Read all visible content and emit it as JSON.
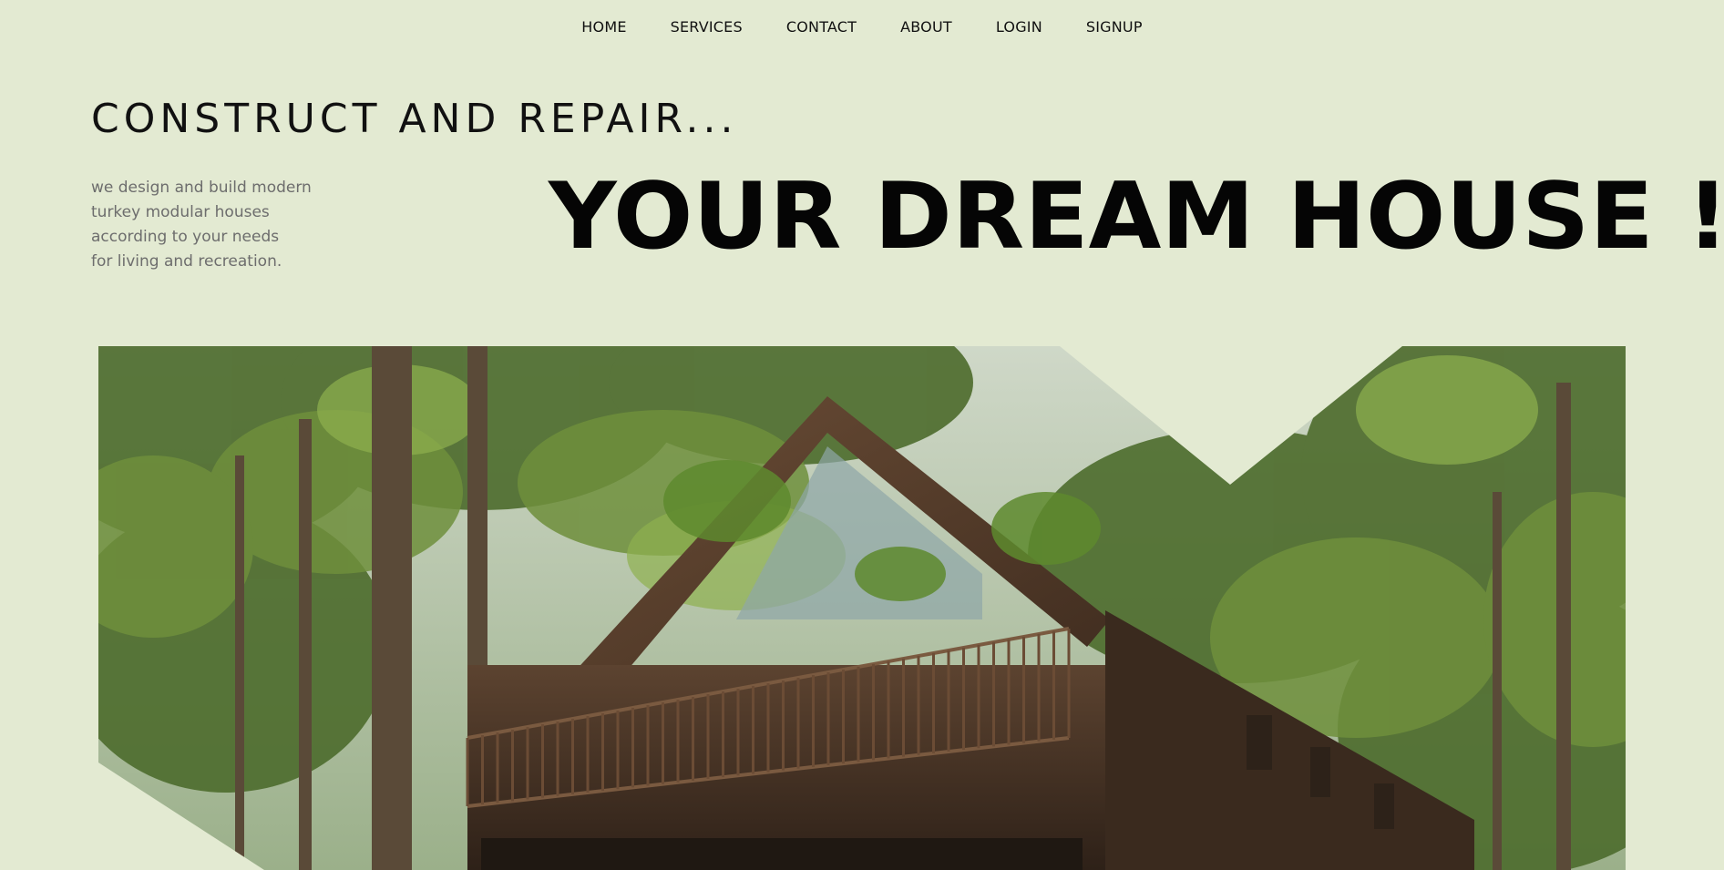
{
  "nav": {
    "items": [
      {
        "label": "HOME"
      },
      {
        "label": "SERVICES"
      },
      {
        "label": "CONTACT"
      },
      {
        "label": "ABOUT"
      },
      {
        "label": "LOGIN"
      },
      {
        "label": "SIGNUP"
      }
    ]
  },
  "hero": {
    "tagline": "CONSTRUCT AND REPAIR...",
    "description_lines": [
      "we design and build modern",
      "turkey modular houses",
      "according to your needs",
      "for living and recreation."
    ],
    "headline": "YOUR DREAM HOUSE !",
    "image_subject": "wooden house among green trees"
  },
  "colors": {
    "background": "#e3ead2",
    "text": "#111111",
    "muted_text": "#6d6d6d"
  }
}
